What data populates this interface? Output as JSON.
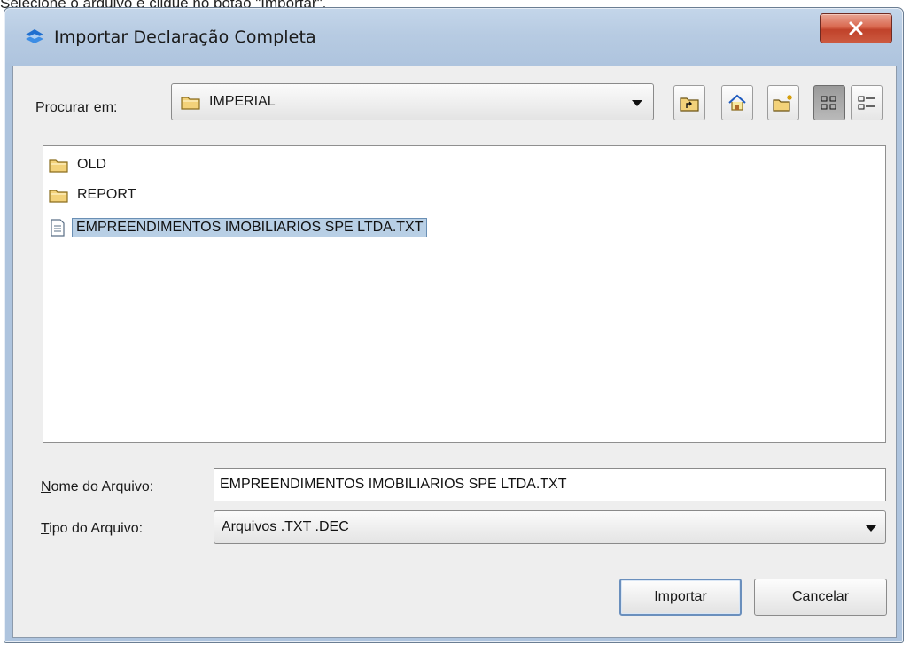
{
  "caption": "Selecione o arquivo e clique no botão \"Importar\".",
  "window": {
    "title": "Importar Declaração Completa",
    "close_glyph": "X"
  },
  "lookin": {
    "label_pre": "Procurar ",
    "label_mnemonic": "e",
    "label_post": "m:",
    "current_folder": "IMPERIAL",
    "toolbar_icons": [
      "up-folder-icon",
      "home-icon",
      "new-folder-icon",
      "list-view-icon",
      "details-view-icon"
    ],
    "active_view": "list-view"
  },
  "files": [
    {
      "name": "OLD",
      "type": "folder"
    },
    {
      "name": "REPORT",
      "type": "folder"
    },
    {
      "name": "EMPREENDIMENTOS IMOBILIARIOS SPE LTDA.TXT",
      "type": "file",
      "selected": true
    }
  ],
  "filename": {
    "label_mnemonic": "N",
    "label_rest": "ome do Arquivo:",
    "value": "EMPREENDIMENTOS IMOBILIARIOS SPE LTDA.TXT"
  },
  "filetype": {
    "label_mnemonic": "T",
    "label_rest": "ipo do Arquivo:",
    "value": "Arquivos .TXT .DEC"
  },
  "buttons": {
    "import": "Importar",
    "cancel": "Cancelar"
  },
  "colors": {
    "selection_bg": "#b8cfe5",
    "close_red": "#c0422a",
    "title_blue": "#b7cbe2"
  }
}
